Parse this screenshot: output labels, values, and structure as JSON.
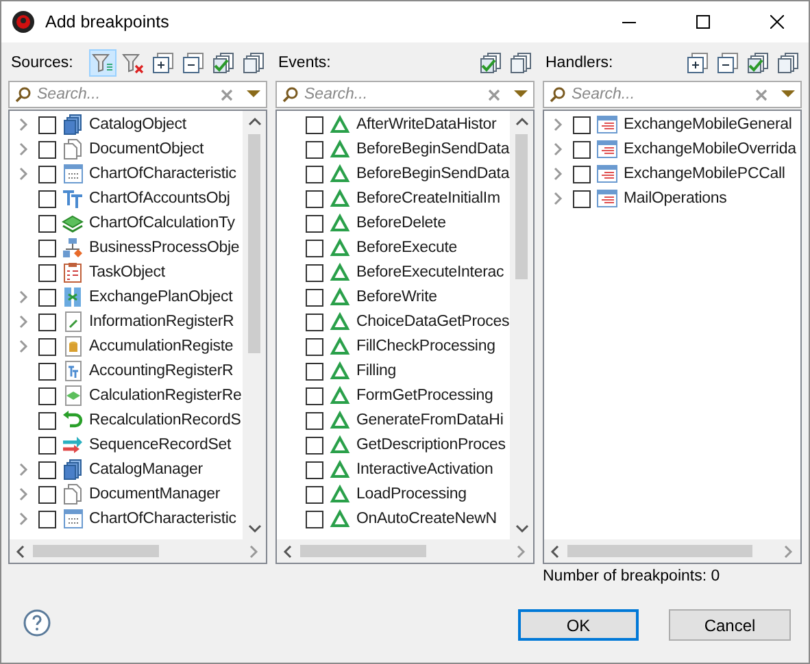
{
  "window": {
    "title": "Add breakpoints"
  },
  "panels": [
    {
      "label": "Sources:",
      "tools": [
        {
          "kind": "filter",
          "selected": true
        },
        {
          "kind": "unfilter",
          "selected": false
        },
        {
          "kind": "expand",
          "selected": false
        },
        {
          "kind": "collapse",
          "selected": false
        },
        {
          "kind": "checkall",
          "selected": false
        },
        {
          "kind": "uncheckall",
          "selected": false
        }
      ],
      "search": {
        "placeholder": "Search..."
      },
      "vscroll": true,
      "items": [
        {
          "label": "CatalogObject",
          "kind": "catalog",
          "expandable": true,
          "checked": false
        },
        {
          "label": "DocumentObject",
          "kind": "document",
          "expandable": true,
          "checked": false
        },
        {
          "label": "ChartOfCharacteristic",
          "kind": "chart",
          "expandable": true,
          "checked": false
        },
        {
          "label": "ChartOfAccountsObj",
          "kind": "accounts",
          "expandable": false,
          "checked": false
        },
        {
          "label": "ChartOfCalculationTy",
          "kind": "calc",
          "expandable": false,
          "checked": false
        },
        {
          "label": "BusinessProcessObje",
          "kind": "process",
          "expandable": false,
          "checked": false
        },
        {
          "label": "TaskObject",
          "kind": "task",
          "expandable": false,
          "checked": false
        },
        {
          "label": "ExchangePlanObject",
          "kind": "exchange",
          "expandable": true,
          "checked": false
        },
        {
          "label": "InformationRegisterR",
          "kind": "inforeg",
          "expandable": true,
          "checked": false
        },
        {
          "label": "AccumulationRegiste",
          "kind": "accum",
          "expandable": true,
          "checked": false
        },
        {
          "label": "AccountingRegisterR",
          "kind": "acctreg",
          "expandable": false,
          "checked": false
        },
        {
          "label": "CalculationRegisterRe",
          "kind": "calcreg",
          "expandable": false,
          "checked": false
        },
        {
          "label": "RecalculationRecordS",
          "kind": "recalc",
          "expandable": false,
          "checked": false
        },
        {
          "label": "SequenceRecordSet",
          "kind": "sequence",
          "expandable": false,
          "checked": false
        },
        {
          "label": "CatalogManager",
          "kind": "catalog",
          "expandable": true,
          "checked": false
        },
        {
          "label": "DocumentManager",
          "kind": "document",
          "expandable": true,
          "checked": false
        },
        {
          "label": "ChartOfCharacteristic",
          "kind": "chart",
          "expandable": true,
          "checked": false
        }
      ]
    },
    {
      "label": "Events:",
      "tools": [
        {
          "kind": "checkall",
          "selected": false
        },
        {
          "kind": "uncheckall",
          "selected": false
        }
      ],
      "search": {
        "placeholder": "Search..."
      },
      "vscroll": true,
      "items": [
        {
          "label": "AfterWriteDataHistor",
          "kind": "event",
          "expandable": false,
          "checked": false
        },
        {
          "label": "BeforeBeginSendData",
          "kind": "event",
          "expandable": false,
          "checked": false
        },
        {
          "label": "BeforeBeginSendData",
          "kind": "event",
          "expandable": false,
          "checked": false
        },
        {
          "label": "BeforeCreateInitialIm",
          "kind": "event",
          "expandable": false,
          "checked": false
        },
        {
          "label": "BeforeDelete",
          "kind": "event",
          "expandable": false,
          "checked": false
        },
        {
          "label": "BeforeExecute",
          "kind": "event",
          "expandable": false,
          "checked": false
        },
        {
          "label": "BeforeExecuteInterac",
          "kind": "event",
          "expandable": false,
          "checked": false
        },
        {
          "label": "BeforeWrite",
          "kind": "event",
          "expandable": false,
          "checked": false
        },
        {
          "label": "ChoiceDataGetProces",
          "kind": "event",
          "expandable": false,
          "checked": false
        },
        {
          "label": "FillCheckProcessing",
          "kind": "event",
          "expandable": false,
          "checked": false
        },
        {
          "label": "Filling",
          "kind": "event",
          "expandable": false,
          "checked": false
        },
        {
          "label": "FormGetProcessing",
          "kind": "event",
          "expandable": false,
          "checked": false
        },
        {
          "label": "GenerateFromDataHi",
          "kind": "event",
          "expandable": false,
          "checked": false
        },
        {
          "label": "GetDescriptionProces",
          "kind": "event",
          "expandable": false,
          "checked": false
        },
        {
          "label": "InteractiveActivation",
          "kind": "event",
          "expandable": false,
          "checked": false
        },
        {
          "label": "LoadProcessing",
          "kind": "event",
          "expandable": false,
          "checked": false
        },
        {
          "label": "OnAutoCreateNewN",
          "kind": "event",
          "expandable": false,
          "checked": false
        }
      ]
    },
    {
      "label": "Handlers:",
      "tools": [
        {
          "kind": "expand",
          "selected": false
        },
        {
          "kind": "collapse",
          "selected": false
        },
        {
          "kind": "checkall",
          "selected": false
        },
        {
          "kind": "uncheckall",
          "selected": false
        }
      ],
      "search": {
        "placeholder": "Search..."
      },
      "vscroll": false,
      "items": [
        {
          "label": "ExchangeMobileGeneral",
          "kind": "module",
          "expandable": true,
          "checked": false
        },
        {
          "label": "ExchangeMobileOverrida",
          "kind": "module",
          "expandable": true,
          "checked": false
        },
        {
          "label": "ExchangeMobilePCCall",
          "kind": "module",
          "expandable": true,
          "checked": false
        },
        {
          "label": "MailOperations",
          "kind": "module",
          "expandable": true,
          "checked": false
        }
      ]
    }
  ],
  "breakpoint_count": "Number of breakpoints: 0",
  "buttons": [
    {
      "label": "OK",
      "kind": "default"
    },
    {
      "label": "Cancel",
      "kind": "normal"
    }
  ]
}
